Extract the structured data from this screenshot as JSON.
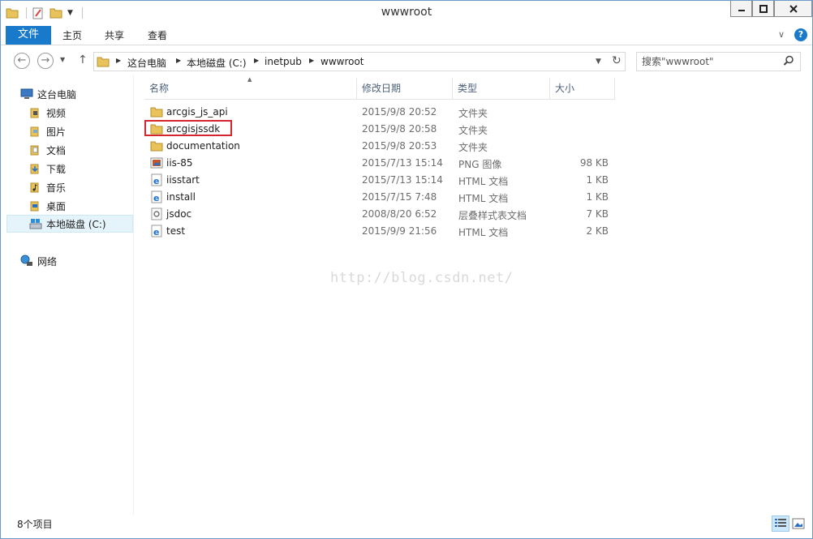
{
  "window": {
    "title": "wwwroot"
  },
  "ribbon": {
    "file_tab": "文件",
    "tabs": [
      "主页",
      "共享",
      "查看"
    ]
  },
  "address": {
    "crumbs": [
      "这台电脑",
      "本地磁盘 (C:)",
      "inetpub",
      "wwwroot"
    ]
  },
  "search": {
    "placeholder": "搜索\"wwwroot\""
  },
  "sidebar": {
    "items": [
      {
        "label": "这台电脑",
        "icon": "computer-icon"
      },
      {
        "label": "视频",
        "icon": "video-folder-icon"
      },
      {
        "label": "图片",
        "icon": "pictures-folder-icon"
      },
      {
        "label": "文档",
        "icon": "documents-folder-icon"
      },
      {
        "label": "下载",
        "icon": "downloads-folder-icon"
      },
      {
        "label": "音乐",
        "icon": "music-folder-icon"
      },
      {
        "label": "桌面",
        "icon": "desktop-folder-icon"
      },
      {
        "label": "本地磁盘 (C:)",
        "icon": "drive-icon",
        "selected": true
      },
      {
        "label": "网络",
        "icon": "network-icon"
      }
    ]
  },
  "columns": {
    "name": "名称",
    "date": "修改日期",
    "type": "类型",
    "size": "大小"
  },
  "files": [
    {
      "name": "arcgis_js_api",
      "date": "2015/9/8 20:52",
      "type": "文件夹",
      "size": "",
      "icon": "folder-icon"
    },
    {
      "name": "arcgisjssdk",
      "date": "2015/9/8 20:58",
      "type": "文件夹",
      "size": "",
      "icon": "folder-icon"
    },
    {
      "name": "documentation",
      "date": "2015/9/8 20:53",
      "type": "文件夹",
      "size": "",
      "icon": "folder-icon"
    },
    {
      "name": "iis-85",
      "date": "2015/7/13 15:14",
      "type": "PNG 图像",
      "size": "98 KB",
      "icon": "png-image-icon"
    },
    {
      "name": "iisstart",
      "date": "2015/7/13 15:14",
      "type": "HTML 文档",
      "size": "1 KB",
      "icon": "ie-html-icon"
    },
    {
      "name": "install",
      "date": "2015/7/15 7:48",
      "type": "HTML 文档",
      "size": "1 KB",
      "icon": "ie-html-icon"
    },
    {
      "name": "jsdoc",
      "date": "2008/8/20 6:52",
      "type": "层叠样式表文档",
      "size": "7 KB",
      "icon": "css-file-icon"
    },
    {
      "name": "test",
      "date": "2015/9/9 21:56",
      "type": "HTML 文档",
      "size": "2 KB",
      "icon": "ie-html-icon"
    }
  ],
  "watermark": "http://blog.csdn.net/",
  "status": {
    "item_count": "8个项目"
  },
  "colors": {
    "accent": "#1979ca",
    "highlight": "#d6262d",
    "folder": "#e8c25a"
  }
}
